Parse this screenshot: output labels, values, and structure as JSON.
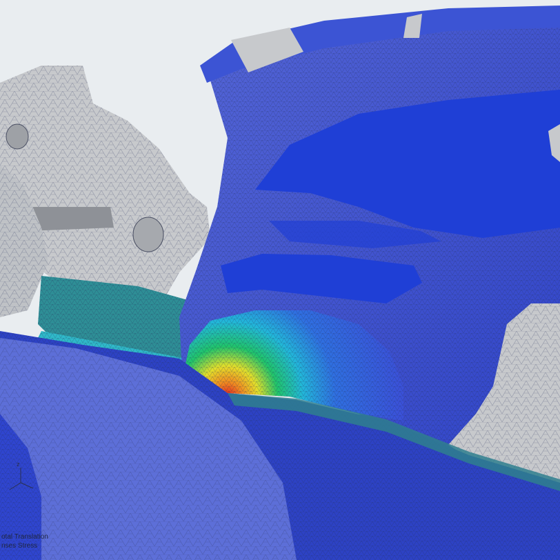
{
  "viewer": {
    "result_legend": {
      "line1": "otal Translation",
      "line2": "nses Stress"
    },
    "axis": {
      "label": "z"
    }
  },
  "colors": {
    "background": "#e9edf0",
    "undeformed_mesh": "#c7c9cc",
    "stress_blue_dark": "#1f3fd6",
    "stress_blue_mid": "#4a5fd8",
    "stress_blue_light": "#6f7fd9",
    "stress_cyan": "#22b7d9",
    "stress_green": "#20c46a",
    "stress_yellow": "#e3df2a",
    "stress_orange": "#f08a20",
    "stress_red": "#e0211f",
    "mesh_line": "#2d3560"
  }
}
